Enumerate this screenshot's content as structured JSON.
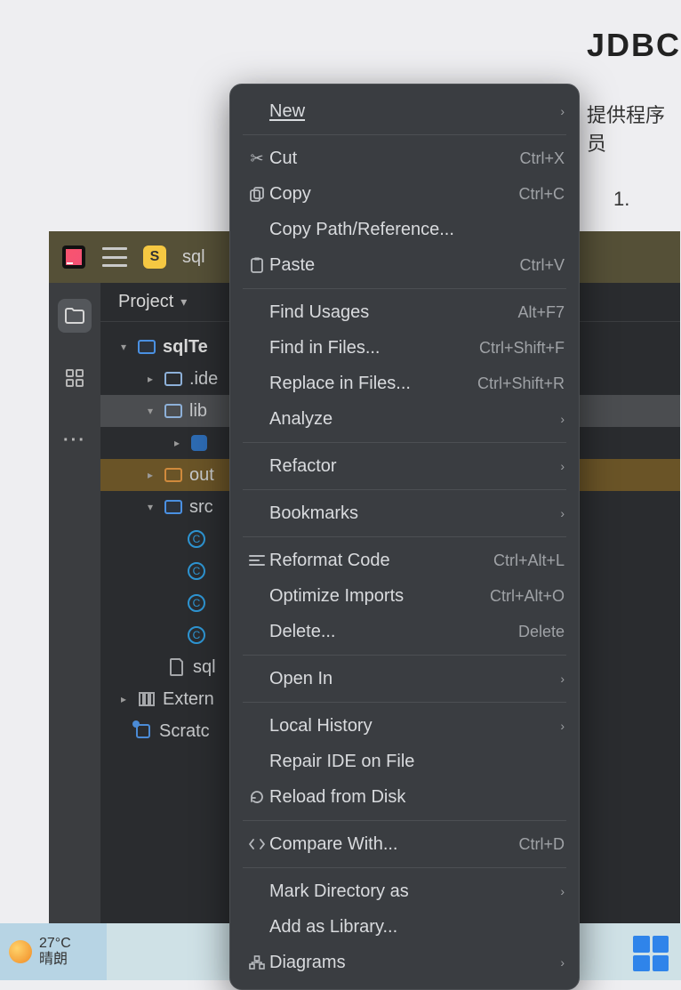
{
  "doc": {
    "title": "JDBC",
    "para": "提供程序员",
    "list_item": "1."
  },
  "ide": {
    "file_chip": "S",
    "file_label": "sql",
    "panel_title": "Project",
    "tree": {
      "root": "sqlTe",
      "idea": ".ide",
      "lib": "lib",
      "out": "out",
      "src": "src",
      "sql_file": "sql",
      "ext_lib": "Extern",
      "scratch": "Scratc"
    }
  },
  "ctx": {
    "new": "New",
    "cut": {
      "label": "Cut",
      "key": "Ctrl+X"
    },
    "copy": {
      "label": "Copy",
      "key": "Ctrl+C"
    },
    "copypath": "Copy Path/Reference...",
    "paste": {
      "label": "Paste",
      "key": "Ctrl+V"
    },
    "findusages": {
      "label": "Find Usages",
      "key": "Alt+F7"
    },
    "findinfiles": {
      "label": "Find in Files...",
      "key": "Ctrl+Shift+F"
    },
    "replaceinfiles": {
      "label": "Replace in Files...",
      "key": "Ctrl+Shift+R"
    },
    "analyze": "Analyze",
    "refactor": "Refactor",
    "bookmarks": "Bookmarks",
    "reformat": {
      "label": "Reformat Code",
      "key": "Ctrl+Alt+L"
    },
    "optimize": {
      "label": "Optimize Imports",
      "key": "Ctrl+Alt+O"
    },
    "delete": {
      "label": "Delete...",
      "key": "Delete"
    },
    "openin": "Open In",
    "localhistory": "Local History",
    "repairide": "Repair IDE on File",
    "reload": "Reload from Disk",
    "compare": {
      "label": "Compare With...",
      "key": "Ctrl+D"
    },
    "markdir": "Mark Directory as",
    "addlib": "Add as Library...",
    "diagrams": "Diagrams"
  },
  "weather": {
    "temp": "27°C",
    "desc": "晴朗"
  }
}
